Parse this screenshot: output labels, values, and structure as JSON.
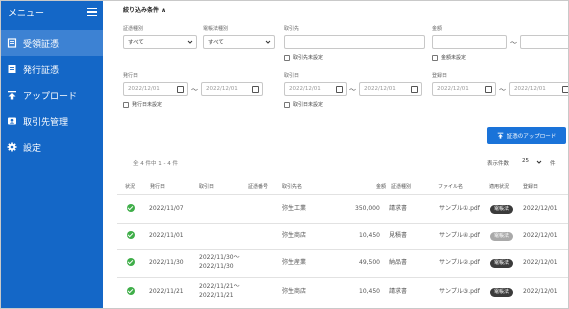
{
  "sidebar": {
    "title": "メニュー",
    "items": [
      {
        "label": "受領証憑",
        "icon": "receipt-icon",
        "active": true
      },
      {
        "label": "発行証憑",
        "icon": "issue-document-icon",
        "active": false
      },
      {
        "label": "アップロード",
        "icon": "upload-icon",
        "active": false
      },
      {
        "label": "取引先管理",
        "icon": "contact-card-icon",
        "active": false
      },
      {
        "label": "設定",
        "icon": "gear-icon",
        "active": false
      }
    ]
  },
  "filters": {
    "title": "絞り込み条件 ∧",
    "doc_type_label": "証憑種別",
    "doc_type_value": "すべて",
    "compliance_label": "電帳法種別",
    "compliance_value": "すべて",
    "partner_label": "取引先",
    "partner_value": "",
    "partner_unset": "取引先未設定",
    "amount_label": "金額",
    "amount_from": "",
    "amount_to": "",
    "amount_unset": "金額未設定",
    "tilde": "〜",
    "issue_date_label": "発行日",
    "issue_date_from": "2022/12/01",
    "issue_date_to": "2022/12/01",
    "issue_date_unset": "発行日未設定",
    "trade_date_label": "取引日",
    "trade_date_from": "2022/12/01",
    "trade_date_to": "2022/12/01",
    "trade_date_unset": "取引日未設定",
    "reg_date_label": "登録日",
    "reg_date_from": "2022/12/01",
    "reg_date_to": "2022/12/01"
  },
  "upload_button": "証憑のアップロード",
  "list": {
    "count_text": "全 4 件中 1 - 4 件",
    "per_page_label": "表示件数",
    "per_page_value": "25",
    "per_page_unit": "件",
    "columns": [
      "状況",
      "発行日",
      "取引日",
      "証憑番号",
      "取引先名",
      "金額",
      "証憑種別",
      "ファイル名",
      "適用状況",
      "登録日"
    ],
    "rows": [
      {
        "status": "ok",
        "issue_date": "2022/11/07",
        "trade_date_1": "",
        "trade_date_2": "",
        "doc_no": "",
        "partner": "弥生工業",
        "amount": "350,000",
        "type": "請求書",
        "file": "サンプル①.pdf",
        "compliance": "電帳法",
        "compliance_color": "#3b3b3b",
        "reg_date": "2022/12/01"
      },
      {
        "status": "ok",
        "issue_date": "2022/11/01",
        "trade_date_1": "",
        "trade_date_2": "",
        "doc_no": "",
        "partner": "弥生商店",
        "amount": "10,450",
        "type": "見積書",
        "file": "サンプル④.pdf",
        "compliance": "電帳法",
        "compliance_color": "#a9a9a9",
        "reg_date": "2022/12/01"
      },
      {
        "status": "ok",
        "issue_date": "2022/11/30",
        "trade_date_1": "2022/11/30〜",
        "trade_date_2": "2022/11/30",
        "doc_no": "",
        "partner": "弥生産業",
        "amount": "49,500",
        "type": "納品書",
        "file": "サンプル②.pdf",
        "compliance": "電帳法",
        "compliance_color": "#3b3b3b",
        "reg_date": "2022/12/01"
      },
      {
        "status": "ok",
        "issue_date": "2022/11/21",
        "trade_date_1": "2022/11/21〜",
        "trade_date_2": "2022/11/21",
        "doc_no": "",
        "partner": "弥生商店",
        "amount": "10,450",
        "type": "請求書",
        "file": "サンプル③.pdf",
        "compliance": "電帳法",
        "compliance_color": "#3b3b3b",
        "reg_date": "2022/12/01"
      }
    ]
  }
}
